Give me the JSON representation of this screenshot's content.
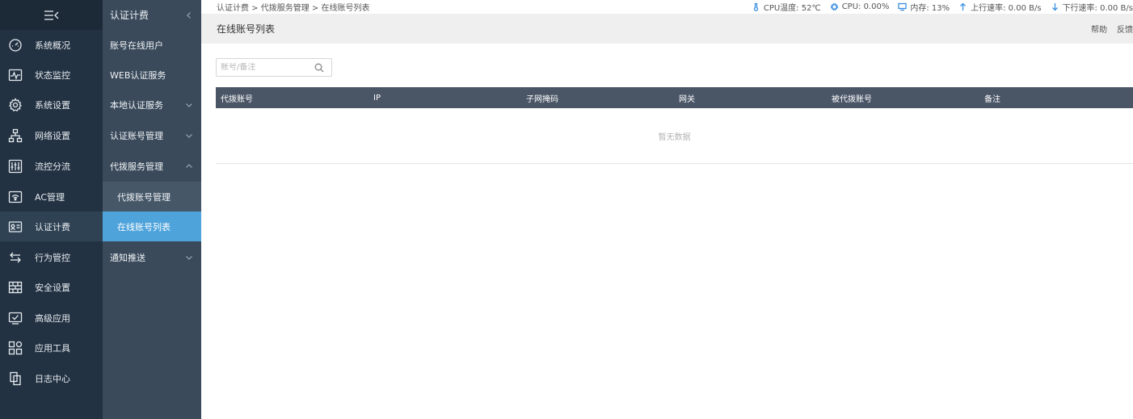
{
  "sidebar": {
    "items": [
      {
        "label": "系统概况",
        "icon": "dashboard-icon"
      },
      {
        "label": "状态监控",
        "icon": "monitor-pulse-icon"
      },
      {
        "label": "系统设置",
        "icon": "gear-icon"
      },
      {
        "label": "网络设置",
        "icon": "network-icon"
      },
      {
        "label": "流控分流",
        "icon": "sliders-icon"
      },
      {
        "label": "AC管理",
        "icon": "wifi-router-icon"
      },
      {
        "label": "认证计费",
        "icon": "id-card-icon"
      },
      {
        "label": "行为管控",
        "icon": "arrows-swap-icon"
      },
      {
        "label": "安全设置",
        "icon": "firewall-icon"
      },
      {
        "label": "高级应用",
        "icon": "checkbox-window-icon"
      },
      {
        "label": "应用工具",
        "icon": "apps-grid-icon"
      },
      {
        "label": "日志中心",
        "icon": "document-copy-icon"
      }
    ]
  },
  "submenu": {
    "header": "认证计费",
    "items": [
      {
        "label": "账号在线用户"
      },
      {
        "label": "WEB认证服务"
      },
      {
        "label": "本地认证服务"
      },
      {
        "label": "认证账号管理"
      },
      {
        "label": "代拨服务管理"
      },
      {
        "label": "代拨账号管理"
      },
      {
        "label": "在线账号列表"
      },
      {
        "label": "通知推送"
      }
    ]
  },
  "topbar": {
    "breadcrumb": "认证计费 > 代拨服务管理 > 在线账号列表",
    "cpu_temp": "CPU温度: 52℃",
    "cpu": "CPU: 0.00%",
    "memory": "内存: 13%",
    "upload": "上行速率: 0.00 B/s",
    "download": "下行速率: 0.00 B/s"
  },
  "page": {
    "title": "在线账号列表",
    "help": "帮助",
    "feedback": "反馈"
  },
  "search": {
    "placeholder": "账号/备注",
    "value": ""
  },
  "table": {
    "columns": [
      "代拨账号",
      "IP",
      "子网掩码",
      "网关",
      "被代拨账号",
      "备注"
    ],
    "rows": [],
    "empty_text": "暂无数据"
  },
  "colors": {
    "sidebar_bg": "#233242",
    "submenu_bg": "#3a4a5b",
    "selected": "#4ea3db",
    "table_header": "#4a5566",
    "icon_accent": "#3a8ee0"
  }
}
